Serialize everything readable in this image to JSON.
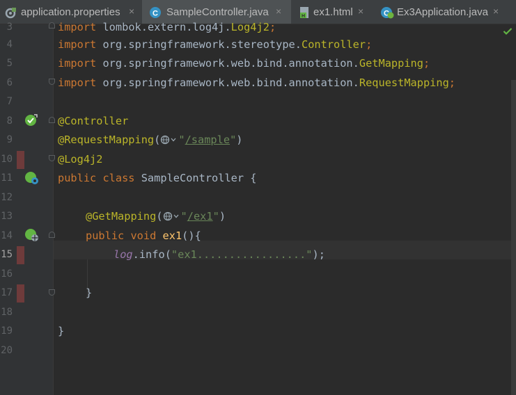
{
  "tabs": [
    {
      "label": "application.properties",
      "icon": "properties-file-icon",
      "active": false
    },
    {
      "label": "SampleController.java",
      "icon": "java-class-icon",
      "active": true
    },
    {
      "label": "ex1.html",
      "icon": "html-file-icon",
      "active": false
    },
    {
      "label": "Ex3Application.java",
      "icon": "spring-app-icon",
      "active": false
    }
  ],
  "close_glyph": "×",
  "line_numbers": [
    "3",
    "4",
    "5",
    "6",
    "7",
    "8",
    "9",
    "10",
    "11",
    "12",
    "13",
    "14",
    "15",
    "16",
    "17",
    "18",
    "19",
    "20"
  ],
  "code": {
    "l3": {
      "kw": "import",
      "pkg": " lombok.extern.log4j.",
      "cls": "Log4j2",
      "end": ";"
    },
    "l4": {
      "kw": "import",
      "pkg": " org.springframework.stereotype.",
      "cls": "Controller",
      "end": ";"
    },
    "l5": {
      "kw": "import",
      "pkg": " org.springframework.web.bind.annotation.",
      "cls": "GetMapping",
      "end": ";"
    },
    "l6": {
      "kw": "import",
      "pkg": " org.springframework.web.bind.annotation.",
      "cls": "RequestMapping",
      "end": ";"
    },
    "l8": {
      "ann": "@Controller"
    },
    "l9": {
      "ann": "@RequestMapping",
      "open": "(",
      "q1": "\"",
      "path": "/sample",
      "q2": "\"",
      "close": ")"
    },
    "l10": {
      "ann": "@Log4j2"
    },
    "l11": {
      "kw": "public class",
      "name": " SampleController ",
      "brace": "{"
    },
    "l13": {
      "ann": "@GetMapping",
      "open": "(",
      "q1": "\"",
      "path": "/ex1",
      "q2": "\"",
      "close": ")"
    },
    "l14": {
      "kw": "public void",
      "fn": "ex1",
      "rest": "(){"
    },
    "l15": {
      "field": "log",
      "call": ".info(",
      "str": "\"ex1.................\"",
      "end": ");"
    },
    "l17": {
      "brace": "}"
    },
    "l19": {
      "brace": "}"
    }
  },
  "colors": {
    "keyword": "#cc7832",
    "annotation": "#bbb529",
    "string": "#6a8759",
    "field": "#9876aa",
    "method": "#ffc66d",
    "text": "#a9b7c6"
  },
  "inspection_status": "check-icon"
}
